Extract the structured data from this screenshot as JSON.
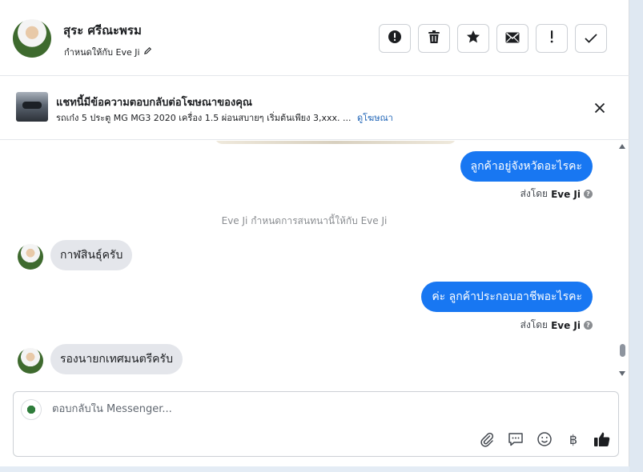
{
  "header": {
    "contact_name": "สุระ ศรีณะพรม",
    "assigned_label": "กำหนดให้กับ Eve Ji",
    "actions": [
      {
        "icon": "alert-circle-icon",
        "name": "spam-button"
      },
      {
        "icon": "trash-icon",
        "name": "delete-button"
      },
      {
        "icon": "star-icon",
        "name": "star-button"
      },
      {
        "icon": "mail-icon",
        "name": "mark-unread-button"
      },
      {
        "icon": "exclamation-icon",
        "name": "follow-up-button"
      },
      {
        "icon": "check-icon",
        "name": "mark-done-button"
      }
    ]
  },
  "ad_banner": {
    "title": "แชทนี้มีข้อความตอบกลับต่อโฆษณาของคุณ",
    "description": "รถเก๋ง 5 ประตู MG MG3 2020 เครื่อง 1.5 ผ่อนสบายๆ เริ่มต้นเพียง 3,xxx. ...",
    "link_label": "ดูโฆษณา"
  },
  "messages": {
    "out_1": "ลูกค้าอยู่จังหวัดอะไรคะ",
    "sent_by_prefix": "ส่งโดย",
    "sent_by_name": "Eve Ji",
    "system_note": "Eve Ji กำหนดการสนทนานี้ให้กับ Eve Ji",
    "in_1": "กาฬสินธุ์ครับ",
    "out_2": "ค่ะ ลูกค้าประกอบอาชีพอะไรคะ",
    "in_2": "รองนายกเทศมนตรีครับ"
  },
  "composer": {
    "placeholder": "ตอบกลับใน Messenger...",
    "tools": [
      "paperclip-icon",
      "saved-reply-icon",
      "emoji-icon",
      "baht-icon",
      "thumbs-up-icon"
    ],
    "baht_symbol": "฿"
  },
  "colors": {
    "outgoing_bubble": "#1877f2",
    "incoming_bubble": "#e4e6eb",
    "link": "#1d63b6"
  }
}
